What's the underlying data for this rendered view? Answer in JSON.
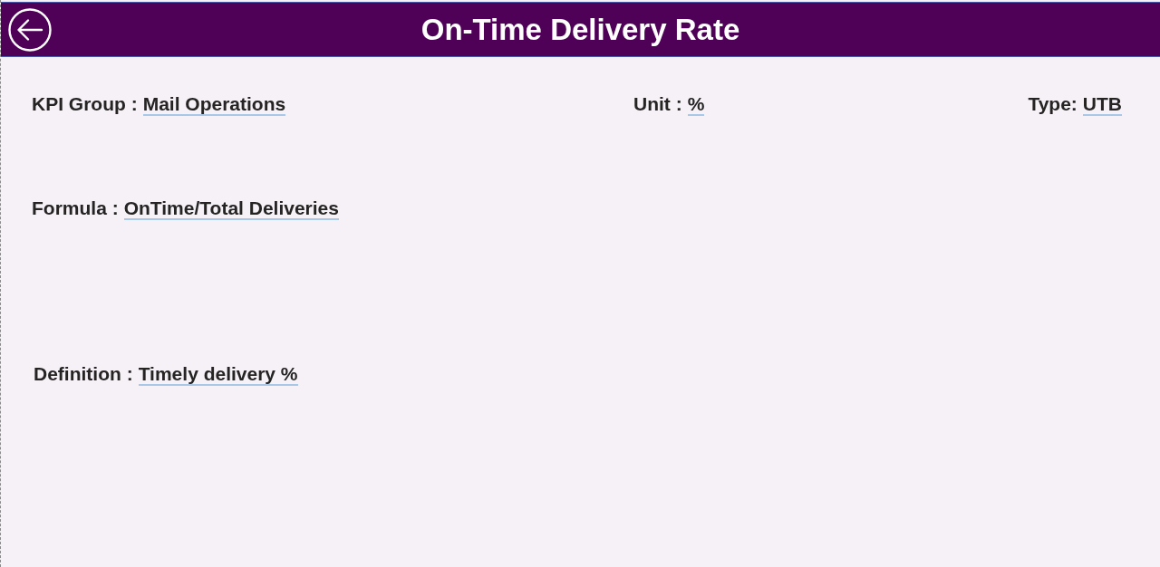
{
  "header": {
    "title": "On-Time Delivery Rate"
  },
  "fields": [
    {
      "label": "KPI Group :",
      "value": "Mail Operations"
    },
    {
      "label": "Unit :",
      "value": "%"
    },
    {
      "label": "Type:",
      "value": "UTB"
    },
    {
      "label": "Formula :",
      "value": "OnTime/Total Deliveries"
    },
    {
      "label": "Definition :",
      "value": "Timely delivery %"
    }
  ]
}
